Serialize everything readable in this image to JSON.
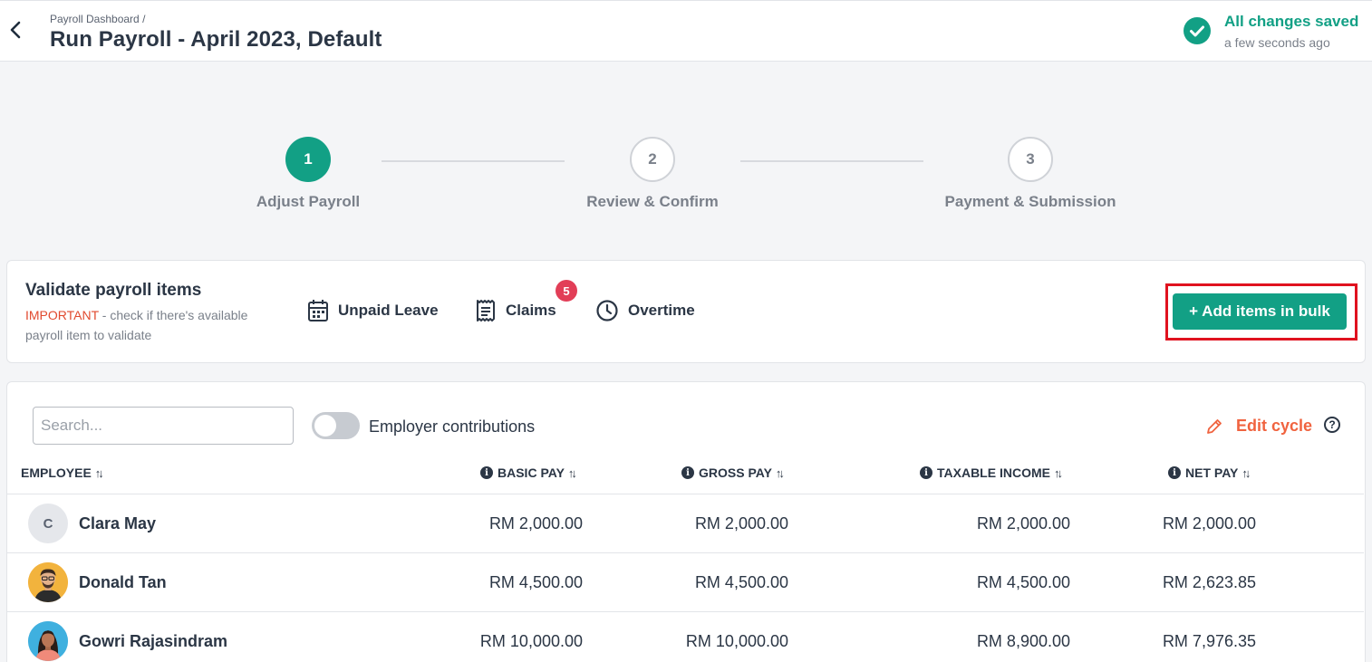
{
  "header": {
    "breadcrumb": "Payroll Dashboard",
    "breadcrumb_sep": "/",
    "title": "Run Payroll - April 2023, Default",
    "save_status": "All changes saved",
    "save_time": "a few seconds ago"
  },
  "steps": [
    {
      "number": "1",
      "label": "Adjust Payroll",
      "active": true
    },
    {
      "number": "2",
      "label": "Review & Confirm",
      "active": false
    },
    {
      "number": "3",
      "label": "Payment & Submission",
      "active": false
    }
  ],
  "validate": {
    "title": "Validate payroll items",
    "important": "IMPORTANT",
    "desc": " - check if there's available payroll item to validate",
    "items": [
      {
        "label": "Unpaid Leave",
        "icon": "calendar-icon"
      },
      {
        "label": "Claims",
        "icon": "receipt-icon",
        "badge": "5"
      },
      {
        "label": "Overtime",
        "icon": "clock-icon"
      }
    ],
    "bulk_button": "+ Add items in bulk"
  },
  "table": {
    "search_placeholder": "Search...",
    "toggle_label": "Employer contributions",
    "edit_cycle": "Edit cycle",
    "help": "?",
    "columns": [
      "EMPLOYEE",
      "BASIC PAY",
      "GROSS PAY",
      "TAXABLE INCOME",
      "NET PAY"
    ],
    "rows": [
      {
        "initial": "C",
        "name": "Clara May",
        "basic": "RM 2,000.00",
        "gross": "RM 2,000.00",
        "taxable": "RM 2,000.00",
        "net": "RM 2,000.00"
      },
      {
        "initial": "",
        "name": "Donald Tan",
        "basic": "RM 4,500.00",
        "gross": "RM 4,500.00",
        "taxable": "RM 4,500.00",
        "net": "RM 2,623.85"
      },
      {
        "initial": "",
        "name": "Gowri Rajasindram",
        "basic": "RM 10,000.00",
        "gross": "RM 10,000.00",
        "taxable": "RM 8,900.00",
        "net": "RM 7,976.35"
      }
    ]
  },
  "colors": {
    "accent": "#12a085",
    "warning": "#e14a2f",
    "badge": "#e23e57",
    "highlight": "#e0121f"
  }
}
